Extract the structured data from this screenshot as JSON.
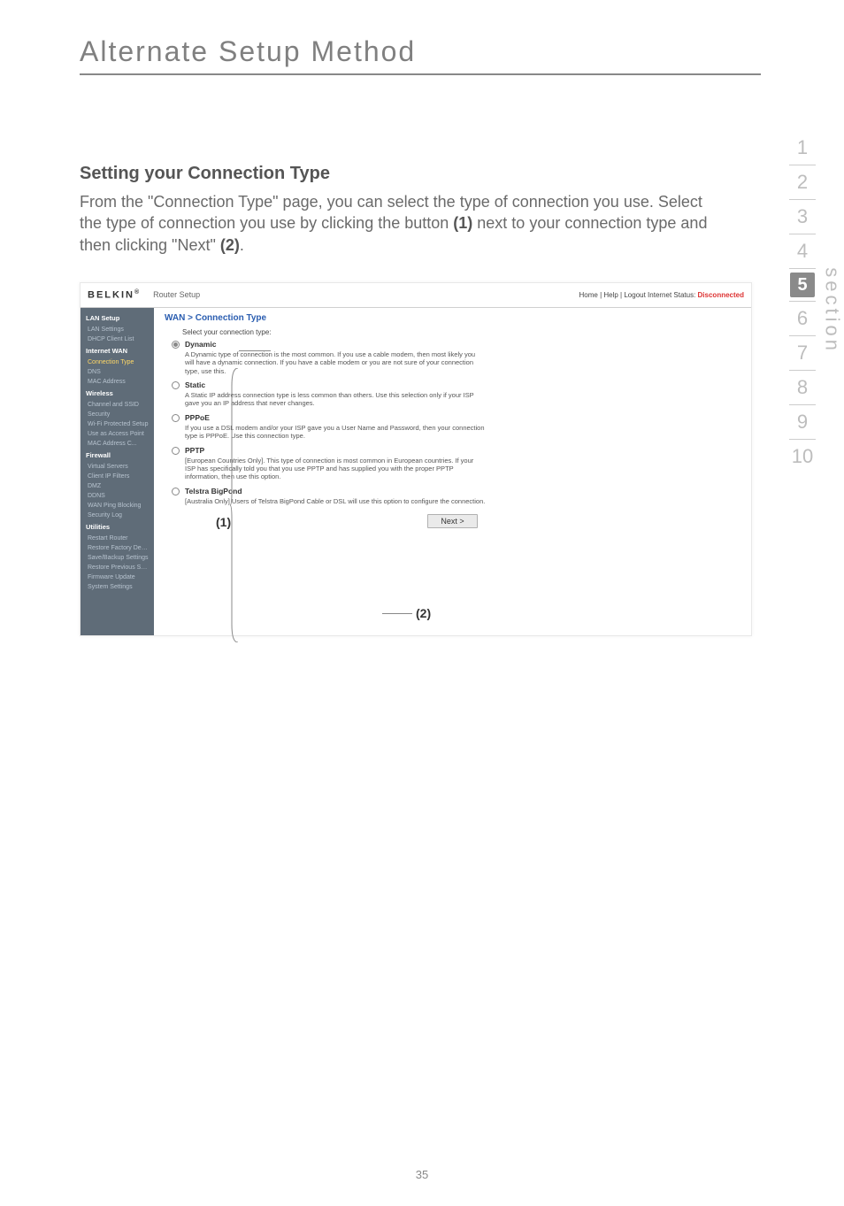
{
  "page": {
    "title": "Alternate Setup Method",
    "heading": "Setting your Connection Type",
    "body_pre": "From the \"Connection Type\" page, you can select the type of connection you use. Select the type of connection you use by clicking the button ",
    "body_b1": "(1)",
    "body_mid": " next to your connection type and then clicking \"Next\" ",
    "body_b2": "(2)",
    "body_end": ".",
    "number": "35"
  },
  "nav": {
    "items": [
      "1",
      "2",
      "3",
      "4",
      "5",
      "6",
      "7",
      "8",
      "9",
      "10"
    ],
    "active_index": 4,
    "label": "section"
  },
  "shot": {
    "brand": "BELKIN",
    "brand_dot": "®",
    "subtitle": "Router Setup",
    "top_links": "Home | Help | Logout   Internet Status: ",
    "status": "Disconnected",
    "sidebar": {
      "g1": "LAN Setup",
      "g1_items": [
        "LAN Settings",
        "DHCP Client List"
      ],
      "g2": "Internet WAN",
      "g2_items_active": "Connection Type",
      "g2_items_rest": [
        "DNS",
        "MAC Address"
      ],
      "g3": "Wireless",
      "g3_items": [
        "Channel and SSID",
        "Security",
        "Wi-Fi Protected Setup",
        "Use as Access Point",
        "MAC Address C..."
      ],
      "g4": "Firewall",
      "g4_items": [
        "Virtual Servers",
        "Client IP Filters",
        "DMZ",
        "DDNS",
        "WAN Ping Blocking",
        "Security Log"
      ],
      "g5": "Utilities",
      "g5_items": [
        "Restart Router",
        "Restore Factory Default",
        "Save/Backup Settings",
        "Restore Previous Settings",
        "Firmware Update",
        "System Settings"
      ]
    },
    "main": {
      "crumb": "WAN > Connection Type",
      "prompt": "Select your connection type:",
      "options": [
        {
          "name": "Dynamic",
          "desc": "A Dynamic type of connection is the most common. If you use a cable modem, then most likely you will have a dynamic connection. If you have a cable modem or you are not sure of your connection type, use this."
        },
        {
          "name": "Static",
          "desc": "A Static IP address connection type is less common than others. Use this selection only if your ISP gave you an IP address that never changes."
        },
        {
          "name": "PPPoE",
          "desc": "If you use a DSL modem and/or your ISP gave you a User Name and Password, then your connection type is PPPoE. Use this connection type."
        },
        {
          "name": "PPTP",
          "desc": "[European Countries Only]. This type of connection is most common in European countries. If your ISP has specifically told you that you use PPTP and has supplied you with the proper PPTP information, then use this option."
        },
        {
          "name": "Telstra BigPond",
          "desc": "[Australia Only] Users of Telstra BigPond Cable or DSL will use this option to configure the connection."
        }
      ],
      "next": "Next >"
    },
    "callouts": {
      "one": "(1)",
      "two": "(2)"
    }
  }
}
